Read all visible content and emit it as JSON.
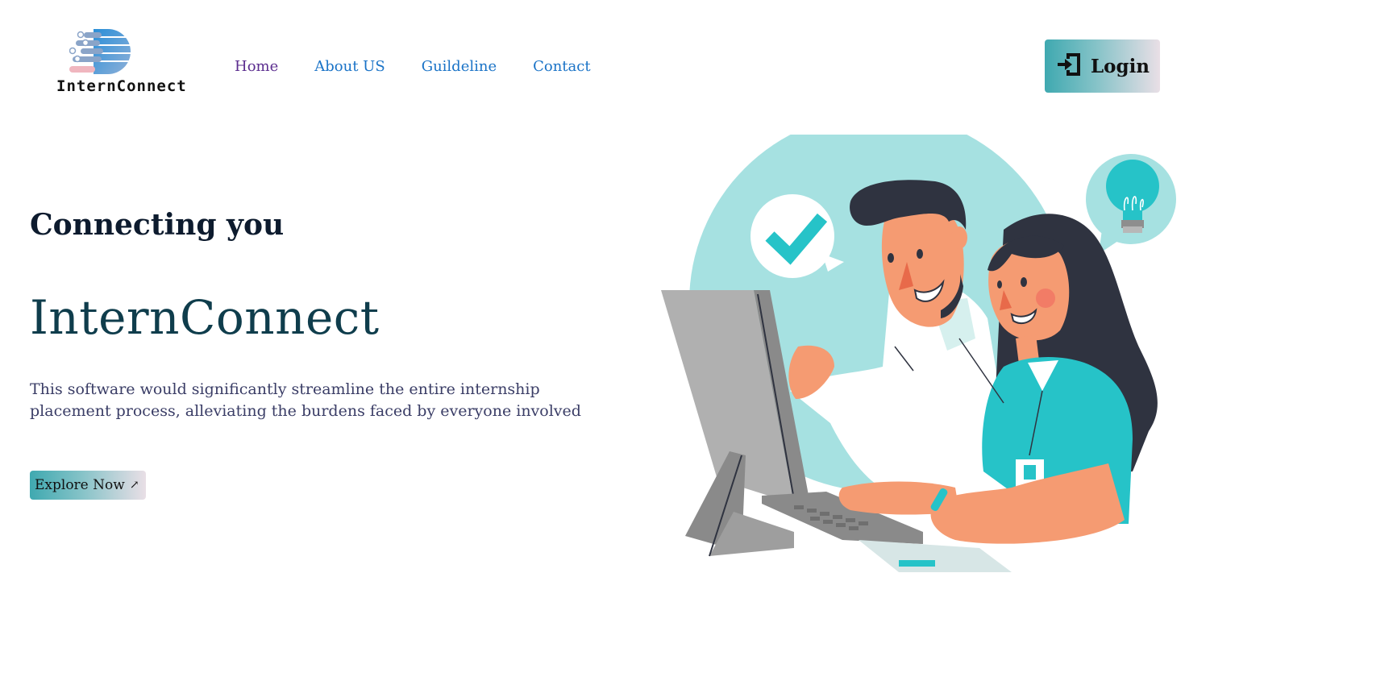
{
  "logo": {
    "text": "InternConnect"
  },
  "nav": [
    {
      "label": "Home"
    },
    {
      "label": "About US"
    },
    {
      "label": "Guildeline"
    },
    {
      "label": "Contact"
    }
  ],
  "login": {
    "label": "Login",
    "icon": "login-door-icon"
  },
  "hero": {
    "tagline": "Connecting you",
    "brand": "InternConnect",
    "description": "This software would significantly streamline the entire internship placement process, alleviating the burdens faced by everyone involved",
    "cta_label": "Explore Now",
    "cta_arrow": "↗"
  },
  "colors": {
    "accent_teal": "#3fa9b0",
    "nav_link": "#1a73c7",
    "nav_active": "#5b2d8f",
    "brand_text": "#0f3d4c",
    "illustration_circle": "#a6e1e1",
    "shirt_teal": "#26c3c8"
  }
}
